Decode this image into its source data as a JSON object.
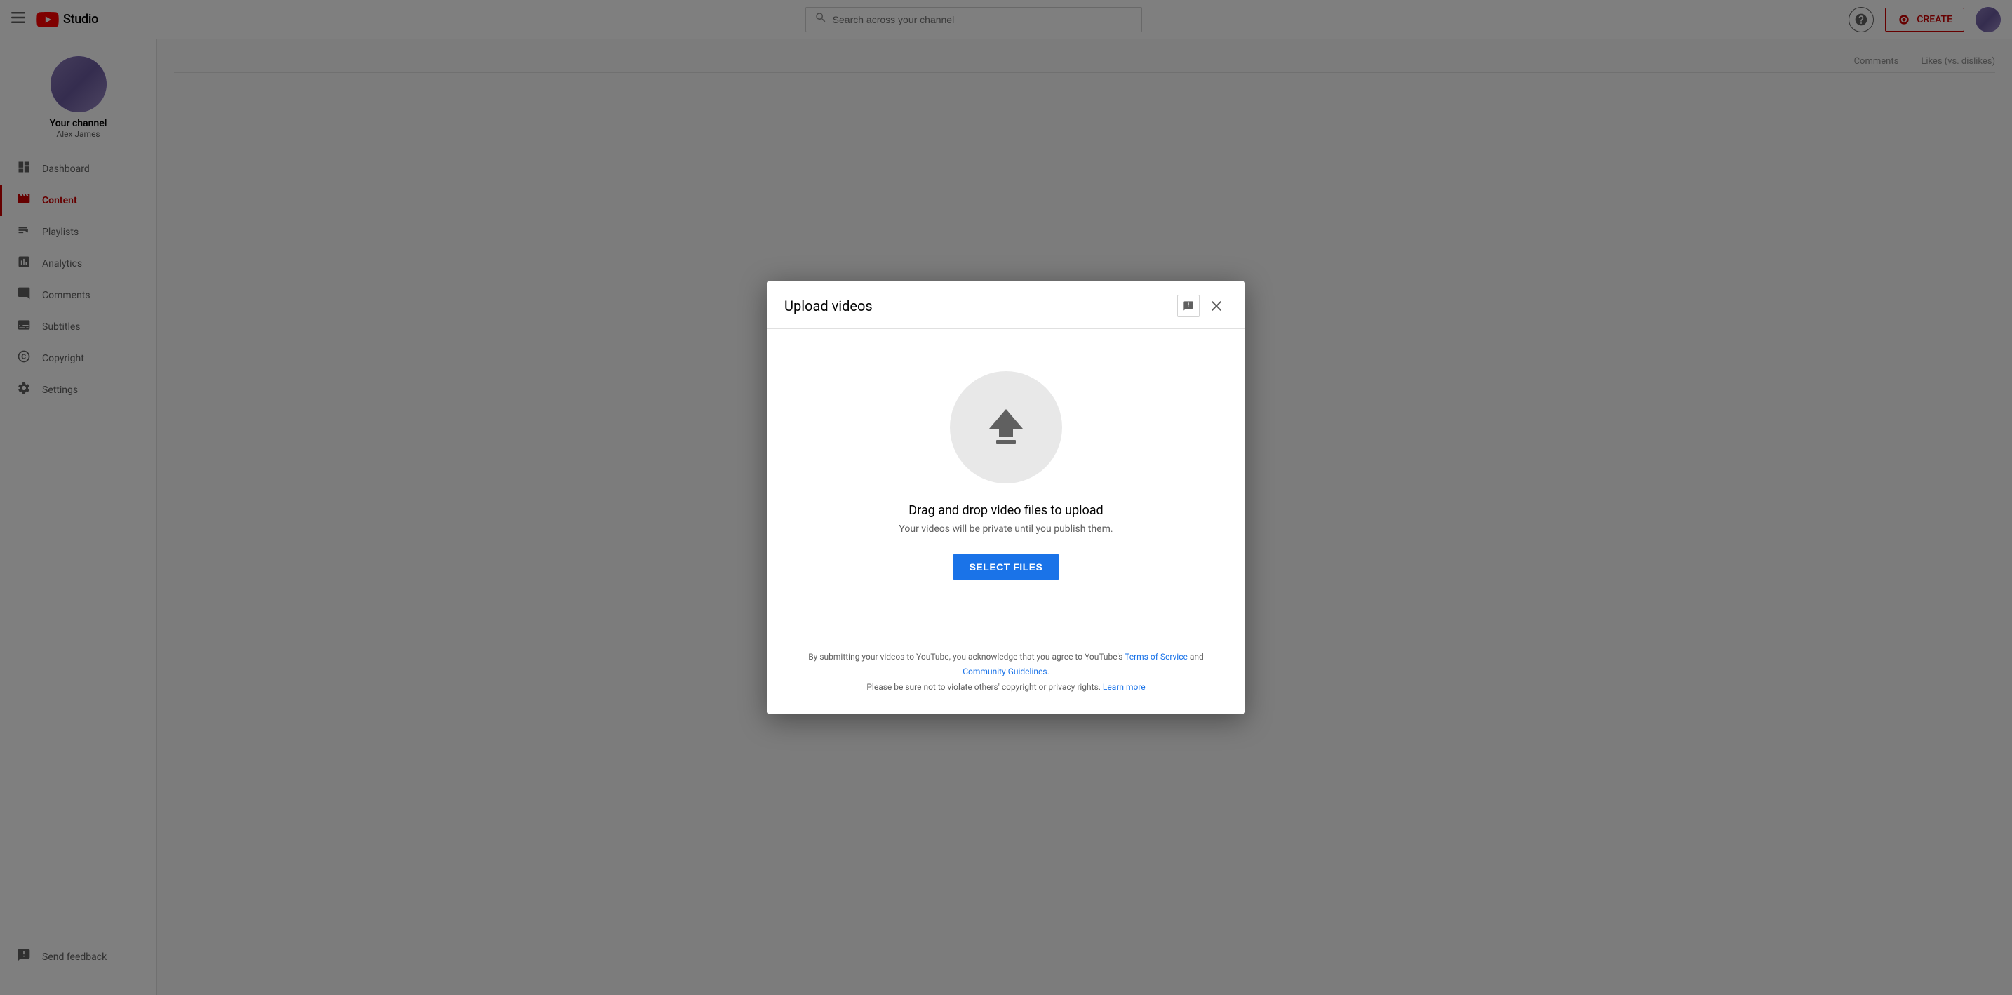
{
  "app": {
    "title": "YouTube Studio",
    "logo_text": "Studio"
  },
  "topnav": {
    "search_placeholder": "Search across your channel",
    "help_icon": "?",
    "create_label": "CREATE",
    "hamburger_icon": "☰"
  },
  "sidebar": {
    "channel_name": "Your channel",
    "channel_handle": "Alex James",
    "nav_items": [
      {
        "id": "dashboard",
        "label": "Dashboard",
        "icon": "⊞"
      },
      {
        "id": "content",
        "label": "Content",
        "icon": "▶",
        "active": true
      },
      {
        "id": "playlists",
        "label": "Playlists",
        "icon": "≡"
      },
      {
        "id": "analytics",
        "label": "Analytics",
        "icon": "▦"
      },
      {
        "id": "comments",
        "label": "Comments",
        "icon": "💬"
      },
      {
        "id": "subtitles",
        "label": "Subtitles",
        "icon": "⊟"
      },
      {
        "id": "copyright",
        "label": "Copyright",
        "icon": "©"
      },
      {
        "id": "settings",
        "label": "Settings",
        "icon": "⚙"
      }
    ],
    "footer_items": [
      {
        "id": "send-feedback",
        "label": "Send feedback",
        "icon": "⚑"
      }
    ]
  },
  "bg_tabs": [
    "Comments",
    "Likes (vs. dislikes)"
  ],
  "modal": {
    "title": "Upload videos",
    "feedback_icon": "!",
    "close_icon": "×",
    "upload_title": "Drag and drop video files to upload",
    "upload_subtitle": "Your videos will be private until you publish them.",
    "select_files_label": "SELECT FILES",
    "footer_line1_prefix": "By submitting your videos to YouTube, you acknowledge that you agree to YouTube's ",
    "footer_tos_label": "Terms of Service",
    "footer_and": " and ",
    "footer_community_label": "Community Guidelines",
    "footer_period": ".",
    "footer_line2_prefix": "Please be sure not to violate others' copyright or privacy rights. ",
    "footer_learn_more": "Learn more"
  }
}
